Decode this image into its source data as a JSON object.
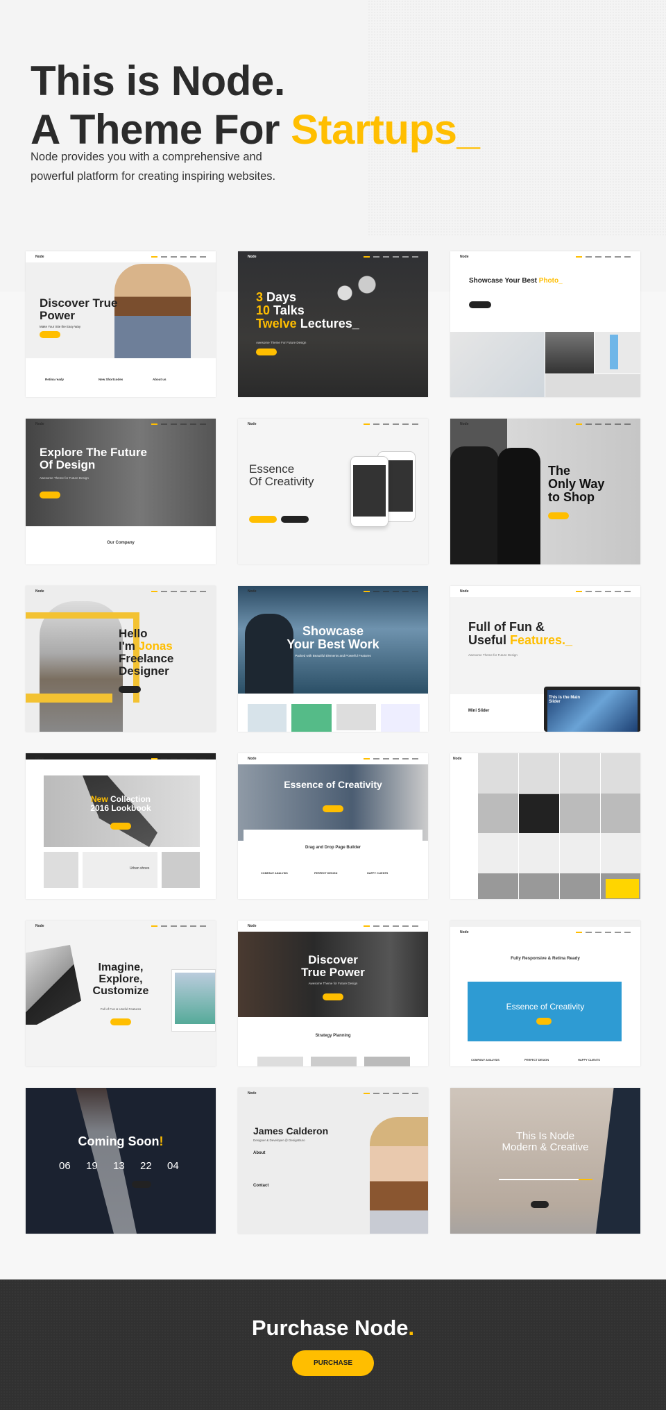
{
  "colors": {
    "accent": "#ffbe00",
    "dark": "#313131",
    "text": "#2b2b2b"
  },
  "hero": {
    "line1": "This is Node.",
    "line2_prefix": "A Theme For ",
    "line2_accent": "Startups",
    "cursor": "_",
    "description": "Node provides you with a comprehensive and powerful platform for creating inspiring websites."
  },
  "cards": [
    {
      "logo": "Node",
      "lines": [
        [
          {
            "t": "Discover True"
          }
        ],
        [
          {
            "t": "Power"
          }
        ]
      ],
      "sub": "Make Your Site the Easy Way",
      "button": true,
      "extras": [
        "Retina ready",
        "New Shortcodes",
        "About us"
      ]
    },
    {
      "logo": "Node",
      "lines": [
        [
          {
            "t": "3 ",
            "a": true
          },
          {
            "t": "Days"
          }
        ],
        [
          {
            "t": "10 ",
            "a": true
          },
          {
            "t": "Talks"
          }
        ],
        [
          {
            "t": "Twelve ",
            "a": true
          },
          {
            "t": "Lectures_"
          }
        ]
      ],
      "sub": "Awesome Theme For Future Design",
      "button": true,
      "extras": []
    },
    {
      "logo": "Node",
      "lines": [
        [
          {
            "t": "Showcase Your Best "
          },
          {
            "t": "Photo_",
            "a": true
          }
        ]
      ],
      "sub": "",
      "button": true,
      "extras": []
    },
    {
      "logo": "Node",
      "lines": [
        [
          {
            "t": "Explore The Future"
          }
        ],
        [
          {
            "t": "Of Design"
          }
        ]
      ],
      "sub": "Awesome Theme for Future Design",
      "button": true,
      "extras": [
        "Our Company"
      ]
    },
    {
      "logo": "Node",
      "lines": [
        [
          {
            "t": "Essence"
          }
        ],
        [
          {
            "t": "Of Creativity"
          }
        ]
      ],
      "sub": "",
      "button": true,
      "extras": []
    },
    {
      "logo": "Node",
      "lines": [
        [
          {
            "t": "The"
          }
        ],
        [
          {
            "t": "Only Way"
          }
        ],
        [
          {
            "t": "to Shop"
          }
        ]
      ],
      "sub": "",
      "button": true,
      "extras": []
    },
    {
      "logo": "Node",
      "lines": [
        [
          {
            "t": "Hello"
          }
        ],
        [
          {
            "t": "I'm "
          },
          {
            "t": "Jonas",
            "a": true
          }
        ],
        [
          {
            "t": "Freelance"
          }
        ],
        [
          {
            "t": "Designer"
          }
        ]
      ],
      "sub": "",
      "button": true,
      "extras": []
    },
    {
      "logo": "Node",
      "lines": [
        [
          {
            "t": "Showcase"
          }
        ],
        [
          {
            "t": "Your Best Work"
          }
        ]
      ],
      "sub": "Packed with Beautiful Elements and Powerful Features",
      "button": false,
      "extras": []
    },
    {
      "logo": "Node",
      "lines": [
        [
          {
            "t": "Full of Fun &"
          }
        ],
        [
          {
            "t": "Useful "
          },
          {
            "t": "Features._",
            "a": true
          }
        ]
      ],
      "sub": "Awesome Theme for Future Design",
      "button": false,
      "extras": [
        "Mini Slider",
        "This is the Main Slider"
      ]
    },
    {
      "logo": "Node",
      "lines": [
        [
          {
            "t": "New ",
            "a": true
          },
          {
            "t": "Collection"
          }
        ],
        [
          {
            "t": "2016 Lookbook"
          }
        ]
      ],
      "sub": "",
      "button": true,
      "extras": [
        "Urban shoes"
      ]
    },
    {
      "logo": "Node",
      "lines": [
        [
          {
            "t": "Essence of Creativity"
          }
        ]
      ],
      "sub": "",
      "button": true,
      "extras": [
        "Drag and Drop Page Builder",
        "COMPANY ANALYSIS",
        "PERFECT DESIGN",
        "HAPPY CLIENTS"
      ]
    },
    {
      "logo": "Node",
      "lines": [],
      "sub": "",
      "button": false,
      "extras": []
    },
    {
      "logo": "Node",
      "lines": [
        [
          {
            "t": "Imagine,"
          }
        ],
        [
          {
            "t": "Explore,"
          }
        ],
        [
          {
            "t": "Customize"
          }
        ]
      ],
      "sub": "Full of Fun & Useful Features",
      "button": true,
      "extras": []
    },
    {
      "logo": "Node",
      "lines": [
        [
          {
            "t": "Discover"
          }
        ],
        [
          {
            "t": "True Power"
          }
        ]
      ],
      "sub": "Awesome Theme for Future Design",
      "button": true,
      "extras": [
        "Strategy Planning"
      ]
    },
    {
      "logo": "Node",
      "lines": [
        [
          {
            "t": "Essence of Creativity"
          }
        ]
      ],
      "sub": "",
      "button": true,
      "extras": [
        "Fully Responsive & Retina Ready",
        "COMPANY ANALYSIS",
        "PERFECT DESIGN",
        "HAPPY CLIENTS"
      ]
    },
    {
      "logo": "",
      "lines": [
        [
          {
            "t": "Coming Soon"
          },
          {
            "t": "!",
            "a": true
          }
        ]
      ],
      "sub": "",
      "button": true,
      "extras": [],
      "countdown": [
        "06",
        "19",
        "13",
        "22",
        "04"
      ]
    },
    {
      "logo": "Node",
      "lines": [
        [
          {
            "t": "James Calderon"
          }
        ]
      ],
      "sub": "Designer & Developer @ DesignBuro",
      "button": false,
      "extras": [
        "About",
        "Contact"
      ]
    },
    {
      "logo": "",
      "lines": [
        [
          {
            "t": "This Is Node"
          }
        ],
        [
          {
            "t": "Modern & Creative"
          }
        ]
      ],
      "sub": "",
      "button": true,
      "extras": []
    }
  ],
  "footer": {
    "title": "Purchase Node",
    "title_accent": ".",
    "button": "PURCHASE"
  }
}
